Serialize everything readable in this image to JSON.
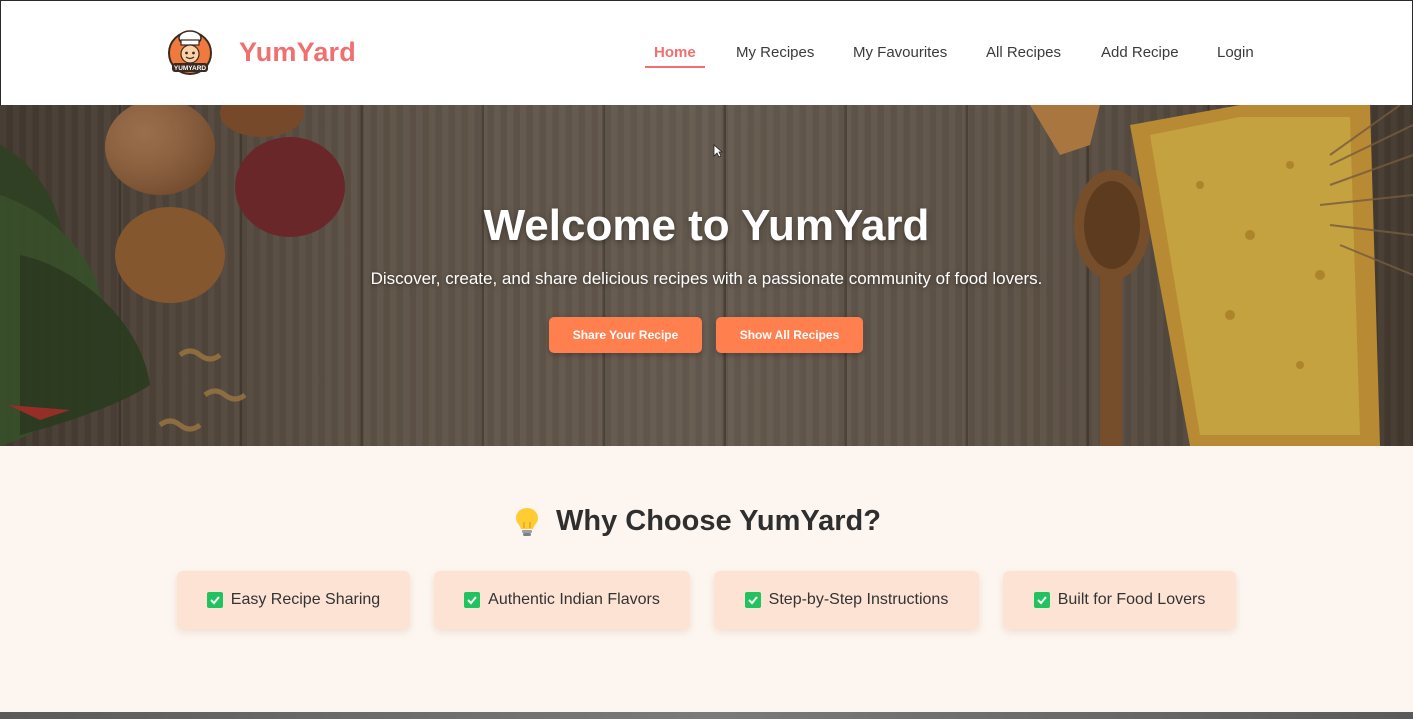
{
  "header": {
    "brand": "YumYard",
    "logo_icon": "chef-mascot-icon",
    "logo_text": "YUMYARD",
    "nav": [
      {
        "label": "Home",
        "active": true
      },
      {
        "label": "My Recipes",
        "active": false
      },
      {
        "label": "My Favourites",
        "active": false
      },
      {
        "label": "All Recipes",
        "active": false
      },
      {
        "label": "Add Recipe",
        "active": false
      },
      {
        "label": "Login",
        "active": false
      }
    ]
  },
  "hero": {
    "title": "Welcome to YumYard",
    "subtitle": "Discover, create, and share delicious recipes with a passionate community of food lovers.",
    "buttons": {
      "share": "Share Your Recipe",
      "show_all": "Show All Recipes"
    }
  },
  "why": {
    "icon": "lightbulb-icon",
    "title": "Why Choose YumYard?",
    "features": [
      {
        "label": "Easy Recipe Sharing",
        "icon": "check-box-icon"
      },
      {
        "label": "Authentic Indian Flavors",
        "icon": "check-box-icon"
      },
      {
        "label": "Step-by-Step Instructions",
        "icon": "check-box-icon"
      },
      {
        "label": "Built for Food Lovers",
        "icon": "check-box-icon"
      }
    ]
  },
  "colors": {
    "brand": "#f06f6f",
    "button": "#ff7f4f",
    "feature_card": "#fde3d4",
    "check": "#22c35e",
    "section_bg": "#fdf6f0"
  }
}
